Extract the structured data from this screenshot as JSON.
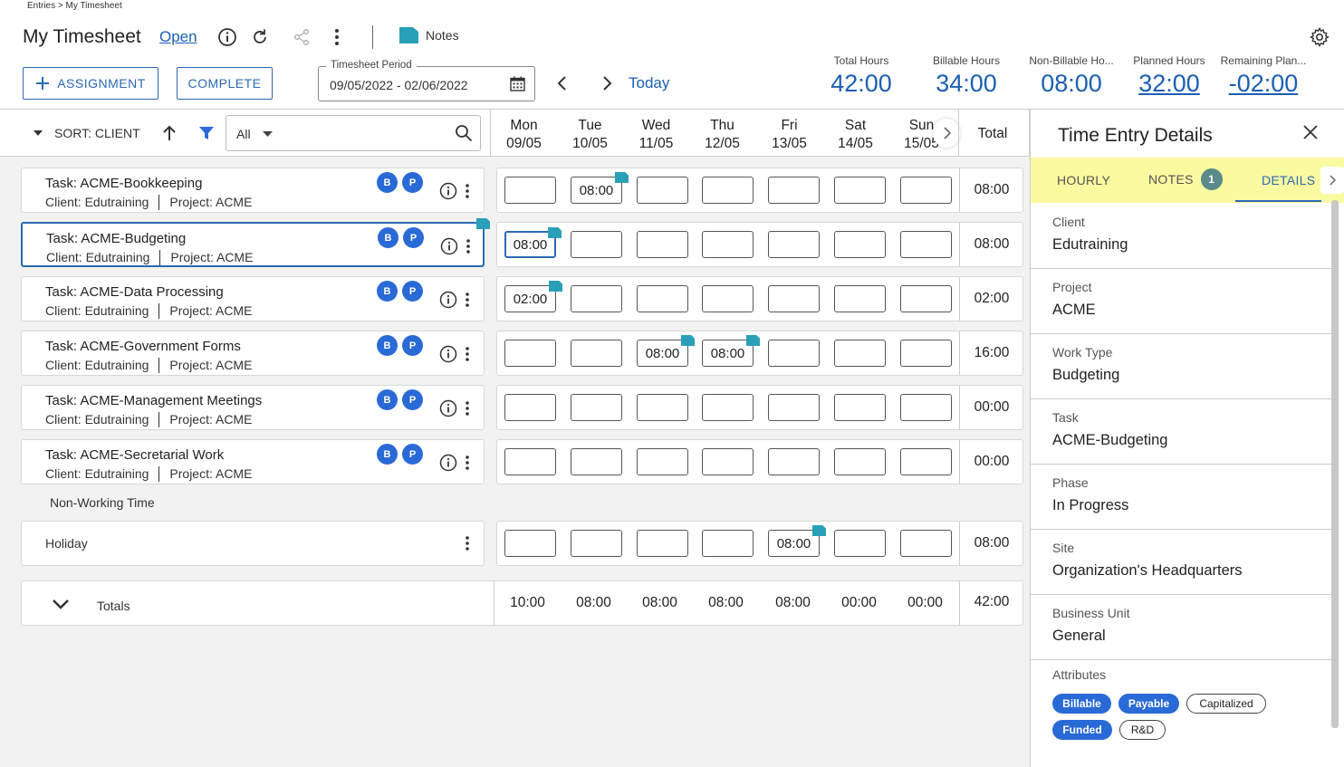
{
  "header": {
    "breadcrumb": "Entries > My Timesheet",
    "title": "My Timesheet",
    "status": "Open",
    "notes_label": "Notes"
  },
  "toolbar": {
    "assignment_label": "ASSIGNMENT",
    "complete_label": "COMPLETE",
    "period_label": "Timesheet Period",
    "period_value": "09/05/2022 - 02/06/2022",
    "today_label": "Today"
  },
  "summary": [
    {
      "label": "Total Hours",
      "value": "42:00"
    },
    {
      "label": "Billable Hours",
      "value": "34:00"
    },
    {
      "label": "Non-Billable Ho...",
      "value": "08:00"
    },
    {
      "label": "Planned Hours",
      "value": "32:00"
    },
    {
      "label": "Remaining Plan...",
      "value": "-02:00"
    }
  ],
  "grid": {
    "sort_label": "SORT: CLIENT",
    "filter_value": "All",
    "total_header": "Total",
    "days": [
      {
        "day": "Mon",
        "date": "09/05"
      },
      {
        "day": "Tue",
        "date": "10/05"
      },
      {
        "day": "Wed",
        "date": "11/05"
      },
      {
        "day": "Thu",
        "date": "12/05"
      },
      {
        "day": "Fri",
        "date": "13/05"
      },
      {
        "day": "Sat",
        "date": "14/05"
      },
      {
        "day": "Sun",
        "date": "15/05"
      }
    ],
    "badges": {
      "b": "B",
      "p": "P"
    },
    "tasks": [
      {
        "task": "Task: ACME-Bookkeeping",
        "client": "Client: Edutraining",
        "project": "Project: ACME",
        "hours": [
          "",
          "08:00",
          "",
          "",
          "",
          "",
          ""
        ],
        "total": "08:00"
      },
      {
        "task": "Task: ACME-Budgeting",
        "client": "Client: Edutraining",
        "project": "Project: ACME",
        "hours": [
          "08:00",
          "",
          "",
          "",
          "",
          "",
          ""
        ],
        "total": "08:00"
      },
      {
        "task": "Task: ACME-Data Processing",
        "client": "Client: Edutraining",
        "project": "Project: ACME",
        "hours": [
          "02:00",
          "",
          "",
          "",
          "",
          "",
          ""
        ],
        "total": "02:00"
      },
      {
        "task": "Task: ACME-Government Forms",
        "client": "Client: Edutraining",
        "project": "Project: ACME",
        "hours": [
          "",
          "",
          "08:00",
          "08:00",
          "",
          "",
          ""
        ],
        "total": "16:00"
      },
      {
        "task": "Task: ACME-Management Meetings",
        "client": "Client: Edutraining",
        "project": "Project: ACME",
        "hours": [
          "",
          "",
          "",
          "",
          "",
          "",
          ""
        ],
        "total": "00:00"
      },
      {
        "task": "Task: ACME-Secretarial Work",
        "client": "Client: Edutraining",
        "project": "Project: ACME",
        "hours": [
          "",
          "",
          "",
          "",
          "",
          "",
          ""
        ],
        "total": "00:00"
      }
    ],
    "non_working_label": "Non-Working Time",
    "holiday": {
      "label": "Holiday",
      "hours": [
        "",
        "",
        "",
        "",
        "08:00",
        "",
        ""
      ],
      "total": "08:00"
    },
    "totals": {
      "label": "Totals",
      "values": [
        "10:00",
        "08:00",
        "08:00",
        "08:00",
        "08:00",
        "00:00",
        "00:00"
      ],
      "total": "42:00"
    }
  },
  "panel": {
    "title": "Time Entry Details",
    "tabs": {
      "hourly": "HOURLY",
      "notes": "NOTES",
      "notes_count": "1",
      "details": "DETAILS"
    },
    "fields": [
      {
        "label": "Client",
        "value": "Edutraining"
      },
      {
        "label": "Project",
        "value": "ACME"
      },
      {
        "label": "Work Type",
        "value": "Budgeting"
      },
      {
        "label": "Task",
        "value": "ACME-Budgeting"
      },
      {
        "label": "Phase",
        "value": "In Progress"
      },
      {
        "label": "Site",
        "value": "Organization's Headquarters"
      },
      {
        "label": "Business Unit",
        "value": "General"
      }
    ],
    "attributes_label": "Attributes",
    "attributes": [
      {
        "label": "Billable",
        "selected": true
      },
      {
        "label": "Payable",
        "selected": true
      },
      {
        "label": "Capitalized",
        "selected": false
      },
      {
        "label": "Funded",
        "selected": true
      },
      {
        "label": "R&D",
        "selected": false
      }
    ]
  },
  "colors": {
    "accent": "#1a5fb4",
    "badge": "#2a6ad6",
    "note_flag": "#2aa0b8",
    "tab_highlight": "#fafaa0"
  }
}
